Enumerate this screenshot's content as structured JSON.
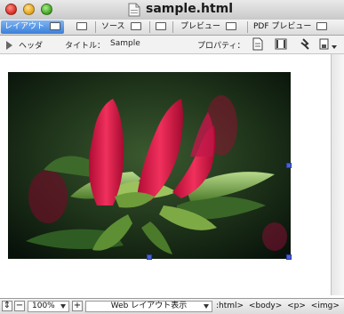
{
  "window": {
    "title": "sample.html"
  },
  "tabs": [
    {
      "label": "レイアウト"
    },
    {
      "label": "ソース"
    },
    {
      "label": "プレビュー"
    },
    {
      "label": "PDF プレビュー"
    }
  ],
  "props": {
    "header_label": "ヘッダ",
    "title_label": "タイトル：",
    "title_value": "Sample",
    "property_label": "プロパティ："
  },
  "status": {
    "zoom": "100%",
    "view_mode": "Web レイアウト表示",
    "tag_path": ":html>  <body>  <p>  <img>"
  },
  "image": {
    "subject": "pink-azalea-buds-photo"
  },
  "colors": {
    "active_tab": "#3a7fdc",
    "selection_handle": "#4a5fd6",
    "bud_pink": "#e8204f"
  }
}
